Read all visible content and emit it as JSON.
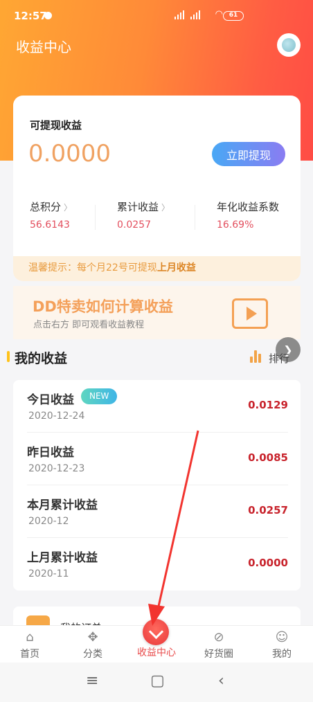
{
  "status_bar": {
    "time": "12:57",
    "battery": "61"
  },
  "header": {
    "title": "收益中心"
  },
  "earnings_card": {
    "label": "可提现收益",
    "amount": "0.0000",
    "withdraw_button": "立即提现",
    "stats": [
      {
        "label": "总积分",
        "value": "56.6143"
      },
      {
        "label": "累计收益",
        "value": "0.0257"
      },
      {
        "label": "年化收益系数",
        "value": "16.69%"
      }
    ],
    "tip_prefix": "温馨提示：每个月22号可提现",
    "tip_highlight": "上月收益"
  },
  "banner": {
    "title": "DD特卖如何计算收益",
    "subtitle": "点击右方 即可观看收益教程"
  },
  "my_earnings": {
    "title": "我的收益",
    "rank_label": "排行",
    "rows": [
      {
        "title": "今日收益",
        "badge": "NEW",
        "date": "2020-12-24",
        "value": "0.0129"
      },
      {
        "title": "昨日收益",
        "date": "2020-12-23",
        "value": "0.0085"
      },
      {
        "title": "本月累计收益",
        "date": "2020-12",
        "value": "0.0257"
      },
      {
        "title": "上月累计收益",
        "date": "2020-11",
        "value": "0.0000"
      }
    ]
  },
  "partial_item": {
    "label": "我的订单"
  },
  "tabbar": {
    "items": [
      {
        "label": "首页",
        "icon": "home-icon"
      },
      {
        "label": "分类",
        "icon": "category-icon"
      },
      {
        "label": "收益中心",
        "icon": "earnings-icon",
        "active": true
      },
      {
        "label": "好货圈",
        "icon": "compass-icon"
      },
      {
        "label": "我的",
        "icon": "profile-icon"
      }
    ]
  },
  "colors": {
    "accent": "#e84a4a",
    "header_start": "#ffa733",
    "header_end": "#ff4c45",
    "value_red": "#c8232c"
  }
}
